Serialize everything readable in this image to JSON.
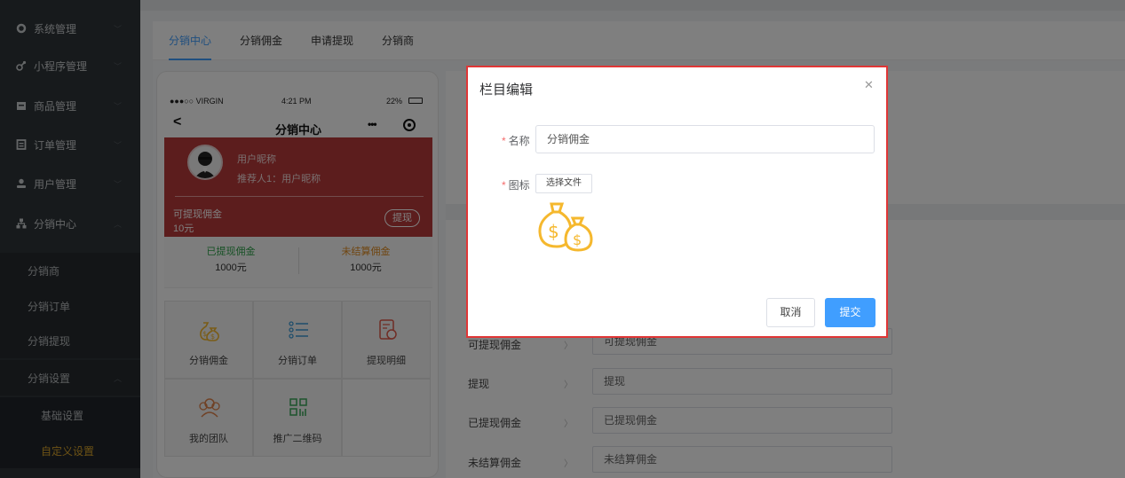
{
  "sidebar": {
    "menus": [
      {
        "label": "系统管理",
        "icon": "circle-icon"
      },
      {
        "label": "小程序管理",
        "icon": "link-icon"
      },
      {
        "label": "商品管理",
        "icon": "product-icon"
      },
      {
        "label": "订单管理",
        "icon": "order-icon"
      },
      {
        "label": "用户管理",
        "icon": "user-icon"
      },
      {
        "label": "分销中心",
        "icon": "network-icon"
      }
    ],
    "sub": [
      {
        "label": "分销商"
      },
      {
        "label": "分销订单"
      },
      {
        "label": "分销提现"
      },
      {
        "label": "分销设置"
      }
    ],
    "deep": [
      {
        "label": "基础设置"
      },
      {
        "label": "自定义设置"
      }
    ]
  },
  "tabs": [
    {
      "label": "分销中心"
    },
    {
      "label": "分销佣金"
    },
    {
      "label": "申请提现"
    },
    {
      "label": "分销商"
    }
  ],
  "phone": {
    "status": {
      "carrier": "●●●○○ VIRGIN",
      "time": "4:21 PM",
      "battery": "22%"
    },
    "nav_title": "分销中心",
    "nickname": "用户昵称",
    "referrer": "推荐人1：用户昵称",
    "available_label": "可提现佣金",
    "available_value": "10元",
    "withdraw_button": "提现",
    "withdrawn_label": "已提现佣金",
    "withdrawn_value": "1000元",
    "unsettled_label": "未结算佣金",
    "unsettled_value": "1000元",
    "grid": [
      {
        "label": "分销佣金",
        "icon": "money-bag-icon"
      },
      {
        "label": "分销订单",
        "icon": "list-icon"
      },
      {
        "label": "提现明细",
        "icon": "detail-icon"
      },
      {
        "label": "我的团队",
        "icon": "team-icon"
      },
      {
        "label": "推广二维码",
        "icon": "qrcode-icon"
      }
    ]
  },
  "right_panel": {
    "rows": [
      {
        "label": "可提现佣金",
        "value": "可提现佣金"
      },
      {
        "label": "提现",
        "value": "提现"
      },
      {
        "label": "已提现佣金",
        "value": "已提现佣金"
      },
      {
        "label": "未结算佣金",
        "value": "未结算佣金"
      }
    ]
  },
  "modal": {
    "title": "栏目编辑",
    "name_label": "名称",
    "name_value": "分销佣金",
    "icon_label": "图标",
    "file_button": "选择文件",
    "cancel": "取消",
    "submit": "提交"
  },
  "colors": {
    "accent": "#409eff",
    "sidebar_bg": "#2e3438",
    "active_sub": "#d9a42b",
    "red_card": "#b83a3a",
    "icon_gold": "#f5b82e",
    "modal_border": "#e03636"
  }
}
